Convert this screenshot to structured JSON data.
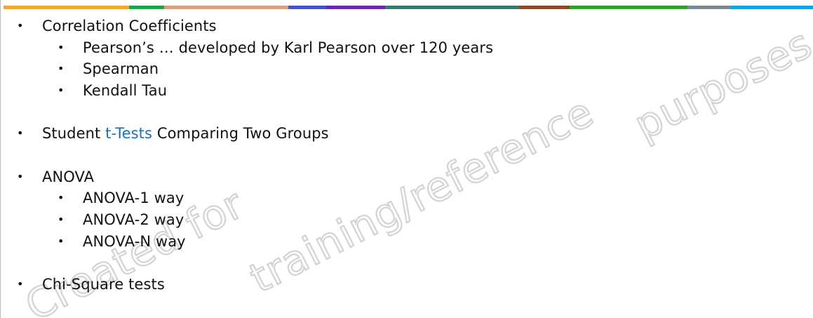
{
  "top_bar_colors": [
    "#f0a830",
    "#1fa34a",
    "#d9a27e",
    "#4356c3",
    "#6a2aa8",
    "#3a7a6e",
    "#8a4a2a",
    "#2ea02c",
    "#7d8a95",
    "#19a3de"
  ],
  "bullets": {
    "item1": "Correlation Coefficients",
    "item1_sub1": "Pearson’s … developed by Karl Pearson over 120 years",
    "item1_sub2": "Spearman",
    "item1_sub3": "Kendall Tau",
    "item2_prefix": "Student ",
    "item2_link": "t-Tests",
    "item2_suffix": " Comparing Two Groups",
    "item3": "ANOVA",
    "item3_sub1": "ANOVA-1 way",
    "item3_sub2": "ANOVA-2 way",
    "item3_sub3": "ANOVA-N way",
    "item4": "Chi-Square tests"
  },
  "watermark": {
    "part1": "Created for",
    "part2": "training/reference",
    "part3": "purposes"
  }
}
